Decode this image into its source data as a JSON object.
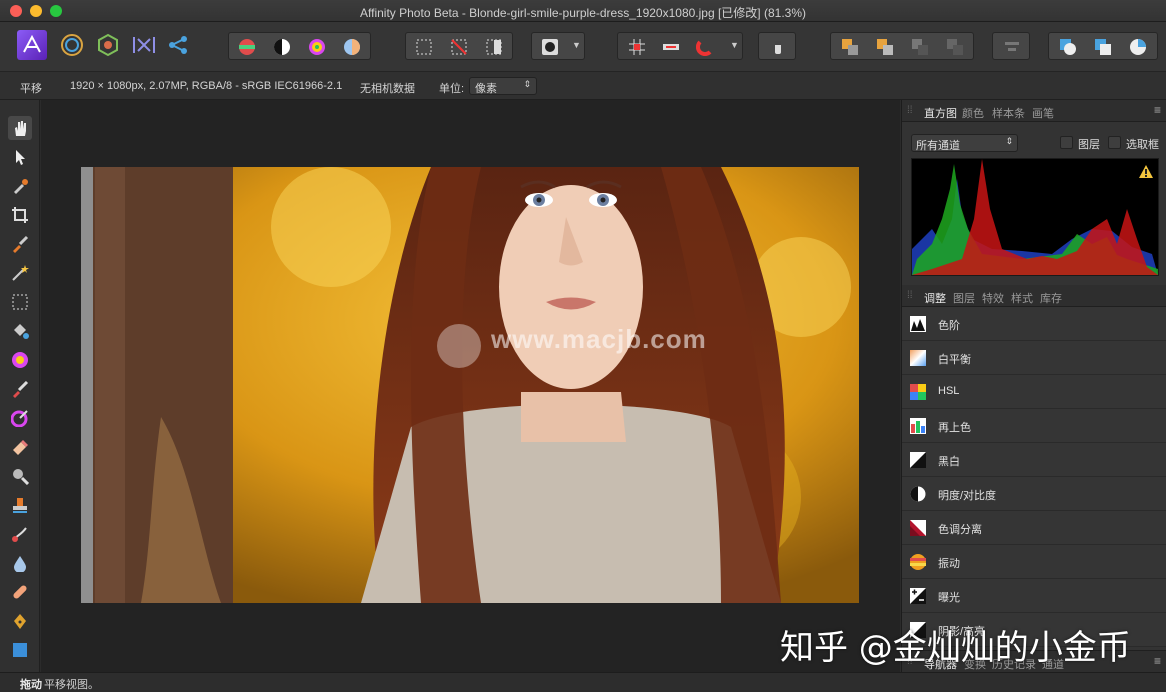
{
  "window": {
    "title": "Affinity Photo Beta - Blonde-girl-smile-purple-dress_1920x1080.jpg [已修改] (81.3%)"
  },
  "context_bar": {
    "tool_name": "平移",
    "doc_info": "1920 × 1080px, 2.07MP, RGBA/8 - sRGB IEC61966-2.1",
    "camera": "无相机数据",
    "unit_label": "单位:",
    "unit_value": "像素"
  },
  "histogram_panel": {
    "tabs": [
      "直方图",
      "颜色",
      "样本条",
      "画笔"
    ],
    "channel_select": "所有通道",
    "layer_checkbox": "图层",
    "selection_checkbox": "选取框"
  },
  "adjustments_panel": {
    "tabs": [
      "调整",
      "图层",
      "特效",
      "样式",
      "库存"
    ],
    "items": [
      {
        "label": "色阶",
        "icon": "levels-icon"
      },
      {
        "label": "白平衡",
        "icon": "white-balance-icon"
      },
      {
        "label": "HSL",
        "icon": "hsl-icon"
      },
      {
        "label": "再上色",
        "icon": "recolor-icon"
      },
      {
        "label": "黑白",
        "icon": "black-white-icon"
      },
      {
        "label": "明度/对比度",
        "icon": "brightness-contrast-icon"
      },
      {
        "label": "色调分离",
        "icon": "posterize-icon"
      },
      {
        "label": "振动",
        "icon": "vibrance-icon"
      },
      {
        "label": "曝光",
        "icon": "exposure-icon"
      },
      {
        "label": "阴影/高亮",
        "icon": "shadows-highlights-icon"
      }
    ]
  },
  "navigator_panel": {
    "tabs": [
      "导航器",
      "变换",
      "历史记录",
      "通道"
    ]
  },
  "canvas": {
    "watermark": "www.macjb.com"
  },
  "status_bar": {
    "action": "拖动",
    "hint": "平移视图。"
  },
  "overlay": {
    "zhihu_watermark": "知乎 @金灿灿的小金币"
  },
  "colors": {
    "accent": "#7b3fd6",
    "traffic_close": "#fc5f57",
    "traffic_min": "#fdbc2e",
    "traffic_max": "#28c840"
  }
}
